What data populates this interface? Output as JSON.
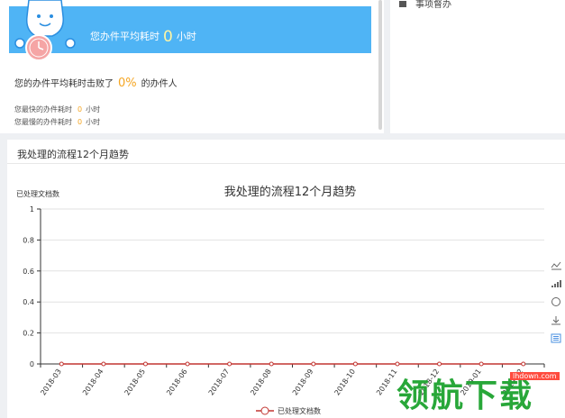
{
  "stats": {
    "banner_prefix": "您办件平均耗时",
    "banner_value": "0",
    "banner_unit": "小时",
    "beat_prefix": "您的办件平均耗时击败了",
    "beat_value": "0%",
    "beat_suffix": "的办件人",
    "fastest_label": "您最快的办件耗时",
    "fastest_value": "0",
    "fastest_unit": "小时",
    "slowest_label": "您最慢的办件耗时",
    "slowest_value": "0",
    "slowest_unit": "小时"
  },
  "todo": {
    "label": "事项督办"
  },
  "panel": {
    "title": "我处理的流程12个月趋势"
  },
  "chart_data": {
    "type": "line",
    "title": "我处理的流程12个月趋势",
    "ylabel": "已处理文档数",
    "xlabel": "",
    "ylim": [
      0,
      1
    ],
    "y_ticks": [
      "0",
      "0.2",
      "0.4",
      "0.6",
      "0.8",
      "1"
    ],
    "categories": [
      "2018-03",
      "2018-04",
      "2018-05",
      "2018-06",
      "2018-07",
      "2018-08",
      "2018-09",
      "2018-10",
      "2018-11",
      "2018-12",
      "2019-01",
      "2019-02"
    ],
    "series": [
      {
        "name": "已处理文档数",
        "values": [
          0,
          0,
          0,
          0,
          0,
          0,
          0,
          0,
          0,
          0,
          0,
          0
        ],
        "color": "#c23531"
      }
    ],
    "grid": true,
    "legend": "bottom"
  },
  "toolbox": [
    "line-chart-icon",
    "bar-chart-icon",
    "restore-icon",
    "download-icon",
    "data-view-icon"
  ],
  "watermark": {
    "site": "lhdown.com",
    "brand": "领航下载"
  }
}
